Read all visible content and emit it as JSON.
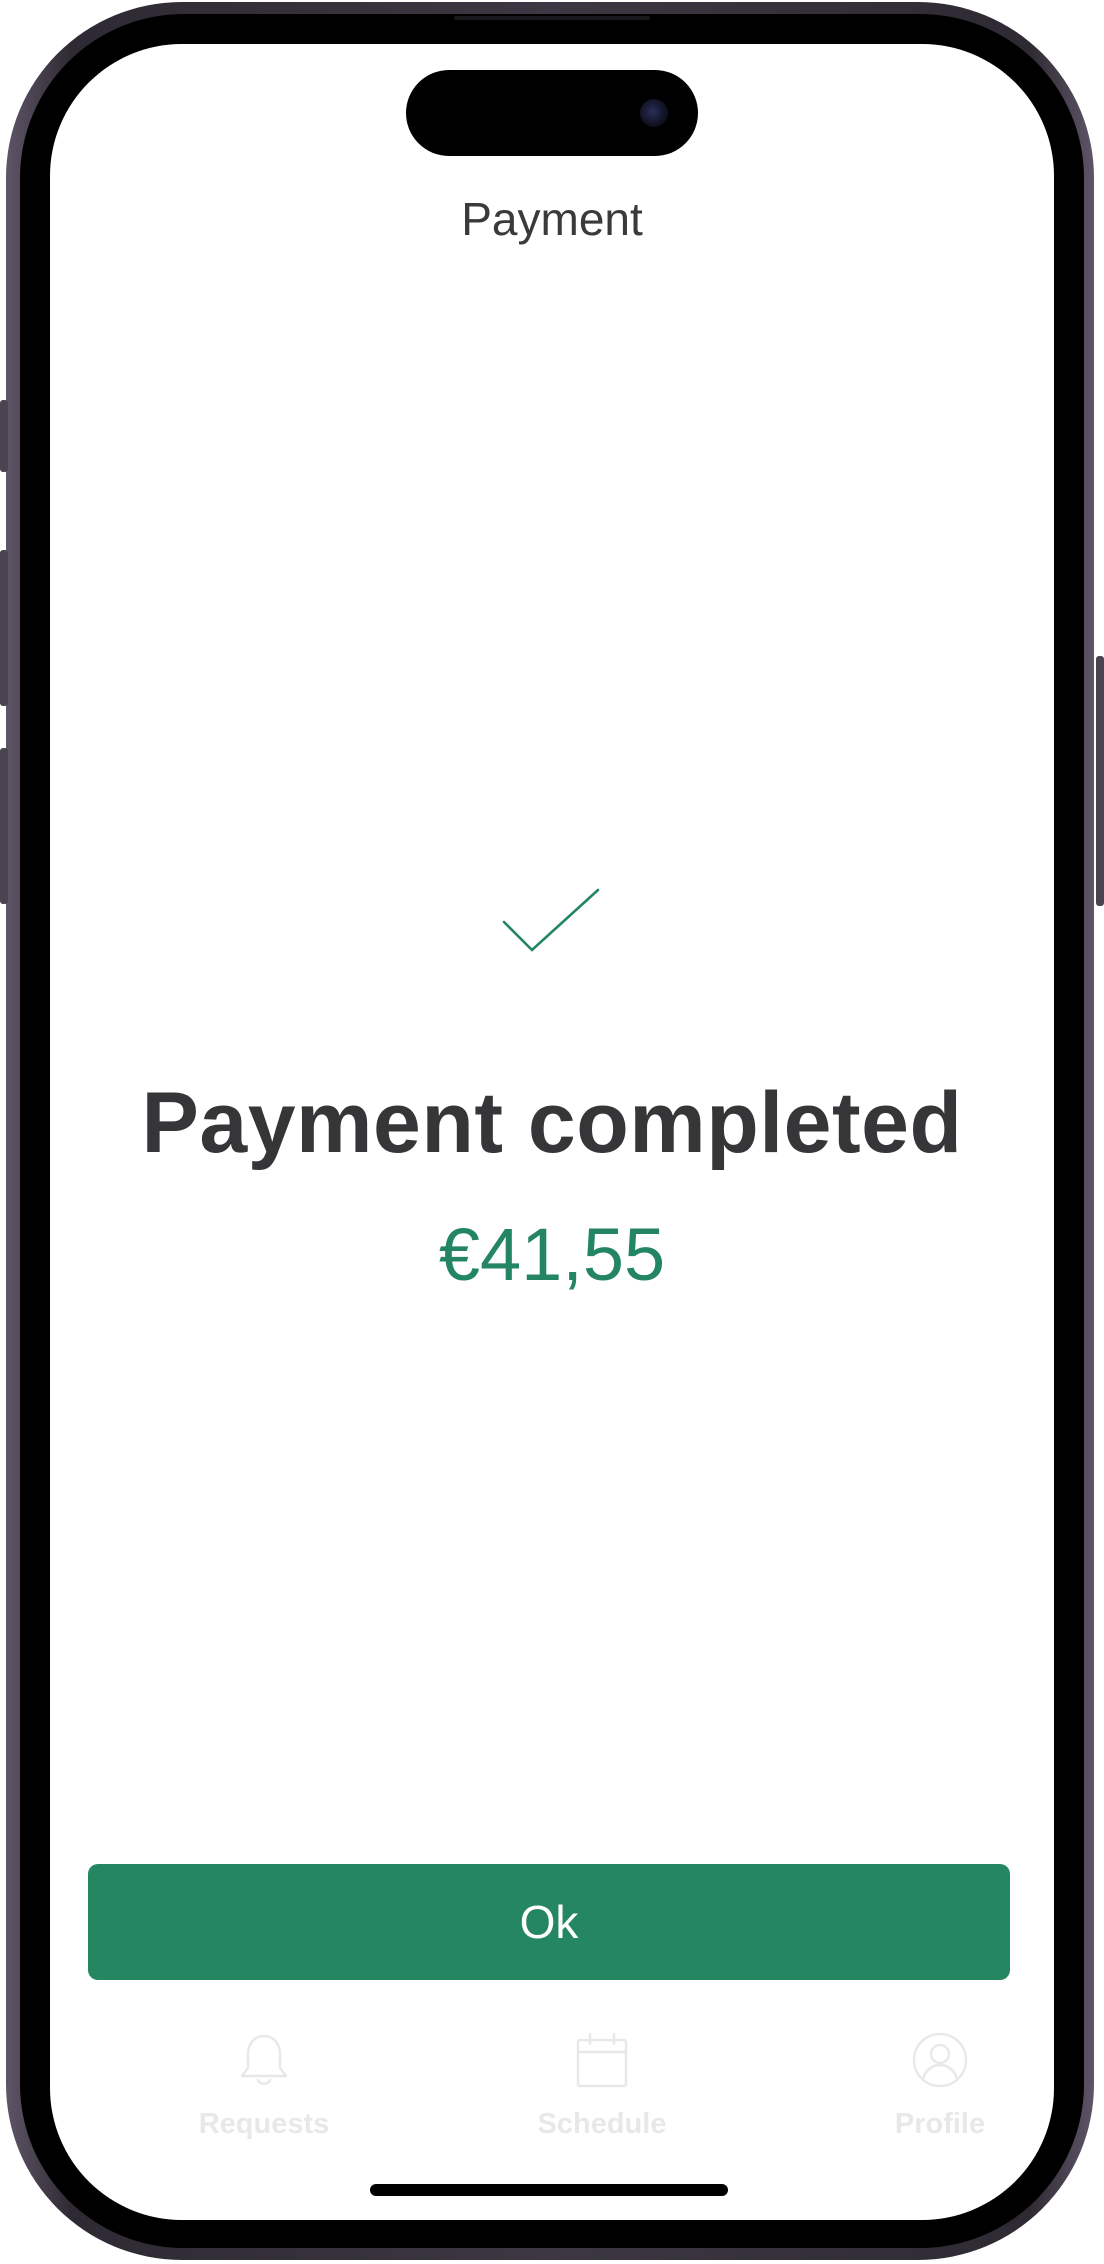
{
  "header": {
    "title": "Payment"
  },
  "result": {
    "status_icon": "checkmark-icon",
    "headline": "Payment completed",
    "amount": "€41,55"
  },
  "actions": {
    "ok_label": "Ok"
  },
  "tabbar": {
    "items": [
      {
        "label": "Requests",
        "icon": "bell-icon"
      },
      {
        "label": "Schedule",
        "icon": "calendar-icon"
      },
      {
        "label": "Profile",
        "icon": "user-circle-icon"
      }
    ]
  },
  "colors": {
    "accent": "#258762",
    "amount_text": "#248563",
    "headline_text": "#363638",
    "tab_inactive": "#e8e8ea"
  }
}
